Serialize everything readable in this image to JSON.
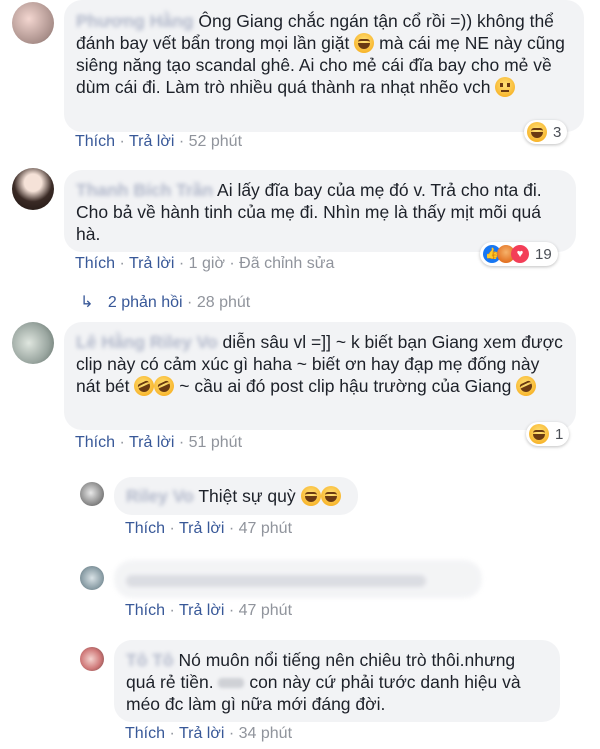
{
  "comments": [
    {
      "author": "Phương Hằng",
      "text": "Ông Giang chắc ngán tận cổ rồi =)) không thể đánh bay vết bẩn trong mọi lần giặt",
      "text2": "mà cái mẹ NE này cũng siêng năng tạo scandal ghê. Ai cho mẻ cái đĩa bay cho mẻ về dùm cái đi. Làm trò nhiều quá thành ra nhạt nhẽo vch",
      "like": "Thích",
      "reply": "Trả lời",
      "time": "52 phút",
      "reaction_count": "3"
    },
    {
      "author": "Thanh Bích Trần",
      "text": "Ai lấy đĩa bay của mẹ đó v. Trả cho nta đi. Cho bả về hành tinh của mẹ đi. Nhìn mẹ là thấy mịt mõi quá hà.",
      "like": "Thích",
      "reply": "Trả lời",
      "time": "1 giờ",
      "edited": "Đã chỉnh sửa",
      "reaction_count": "19",
      "replies_label": "2 phản hồi",
      "replies_time": "28 phút"
    },
    {
      "author": "Lê Hằng Riley Vo",
      "text": "diễn sâu vl =]] ~ k biết bạn Giang xem được clip này có cảm xúc gì haha ~ biết ơn hay đạp mẹ đống này nát bét",
      "text2": "~ cầu ai đó post clip hậu trường của Giang",
      "like": "Thích",
      "reply": "Trả lời",
      "time": "51 phút",
      "reaction_count": "1"
    },
    {
      "author": "Riley Vo",
      "text": "Thiệt sự quỳ",
      "like": "Thích",
      "reply": "Trả lời",
      "time": "47 phút"
    },
    {
      "author": "",
      "text": "",
      "like": "Thích",
      "reply": "Trả lời",
      "time": "47 phút"
    },
    {
      "author": "Tô Tô",
      "text": "Nó muôn nổi tiếng nên chiêu trò thôi.nhưng quá rẻ tiền.",
      "text2": "con này cứ phải tước danh hiệu và méo đc làm gì nữa mới đáng đời.",
      "like": "Thích",
      "reply": "Trả lời",
      "time": "34 phút"
    }
  ],
  "separator": "·",
  "colors": {
    "link": "#385898",
    "meta": "#90949c",
    "bubble": "#f2f3f5"
  }
}
